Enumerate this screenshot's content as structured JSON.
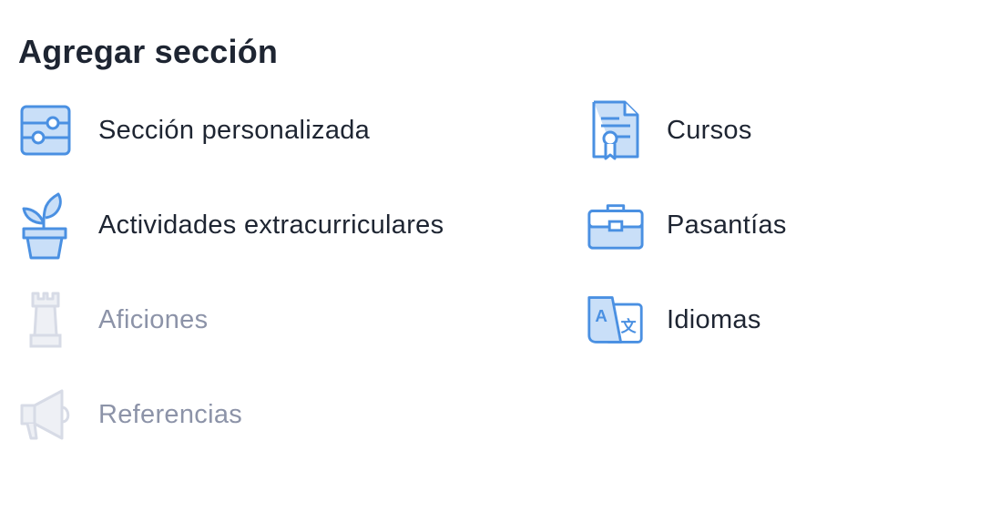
{
  "header": {
    "title": "Agregar sección"
  },
  "colors": {
    "icon_active": "#4a90e2",
    "icon_fill": "#c9dff8",
    "icon_disabled": "#d7dbe6",
    "text_active": "#1e2532",
    "text_disabled": "#8c93a8"
  },
  "sections": {
    "left": [
      {
        "label": "Sección personalizada",
        "icon": "sliders-icon",
        "enabled": true
      },
      {
        "label": "Actividades extracurriculares",
        "icon": "plant-pot-icon",
        "enabled": true
      },
      {
        "label": "Aficiones",
        "icon": "chess-rook-icon",
        "enabled": false
      },
      {
        "label": "Referencias",
        "icon": "megaphone-icon",
        "enabled": false
      }
    ],
    "right": [
      {
        "label": "Cursos",
        "icon": "certificate-icon",
        "enabled": true
      },
      {
        "label": "Pasantías",
        "icon": "briefcase-icon",
        "enabled": true
      },
      {
        "label": "Idiomas",
        "icon": "translate-icon",
        "enabled": true
      }
    ]
  }
}
